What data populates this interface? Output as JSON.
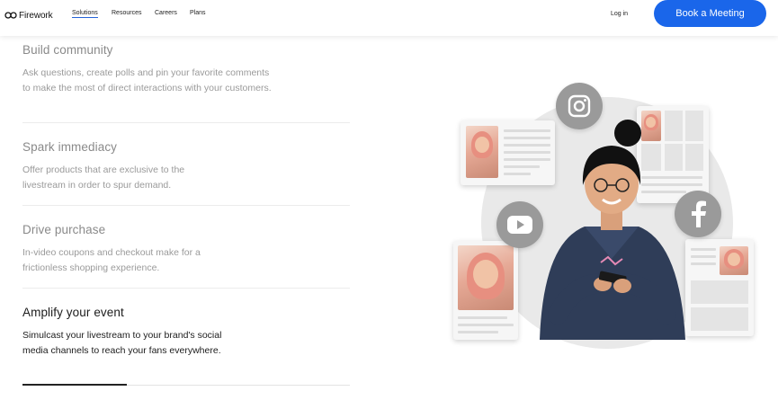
{
  "nav": {
    "logo_text": "Firework",
    "items": [
      {
        "label": "Solutions"
      },
      {
        "label": "Resources"
      },
      {
        "label": "Careers"
      },
      {
        "label": "Plans"
      }
    ],
    "login_label": "Log in",
    "cta_label": "Book a Meeting"
  },
  "features": [
    {
      "title": "Build community",
      "description": "Ask questions, create polls and pin your favorite comments to make the most of direct interactions with your customers."
    },
    {
      "title": "Spark immediacy",
      "description": "Offer products that are exclusive to the livestream in order to spur demand."
    },
    {
      "title": "Drive purchase",
      "description": "In-video coupons and checkout make for a frictionless shopping experience."
    },
    {
      "title": "Amplify your event",
      "description": "Simulcast your livestream to your brand's social media channels to reach your fans everywhere."
    }
  ],
  "active_feature_index": 3,
  "progress_fraction": 0.32,
  "illustration": {
    "icons": [
      "instagram-icon",
      "youtube-icon",
      "facebook-icon"
    ]
  },
  "colors": {
    "accent": "#1a66ea",
    "active_text": "#1c1c1c",
    "inactive_text": "#8a8a8a"
  }
}
